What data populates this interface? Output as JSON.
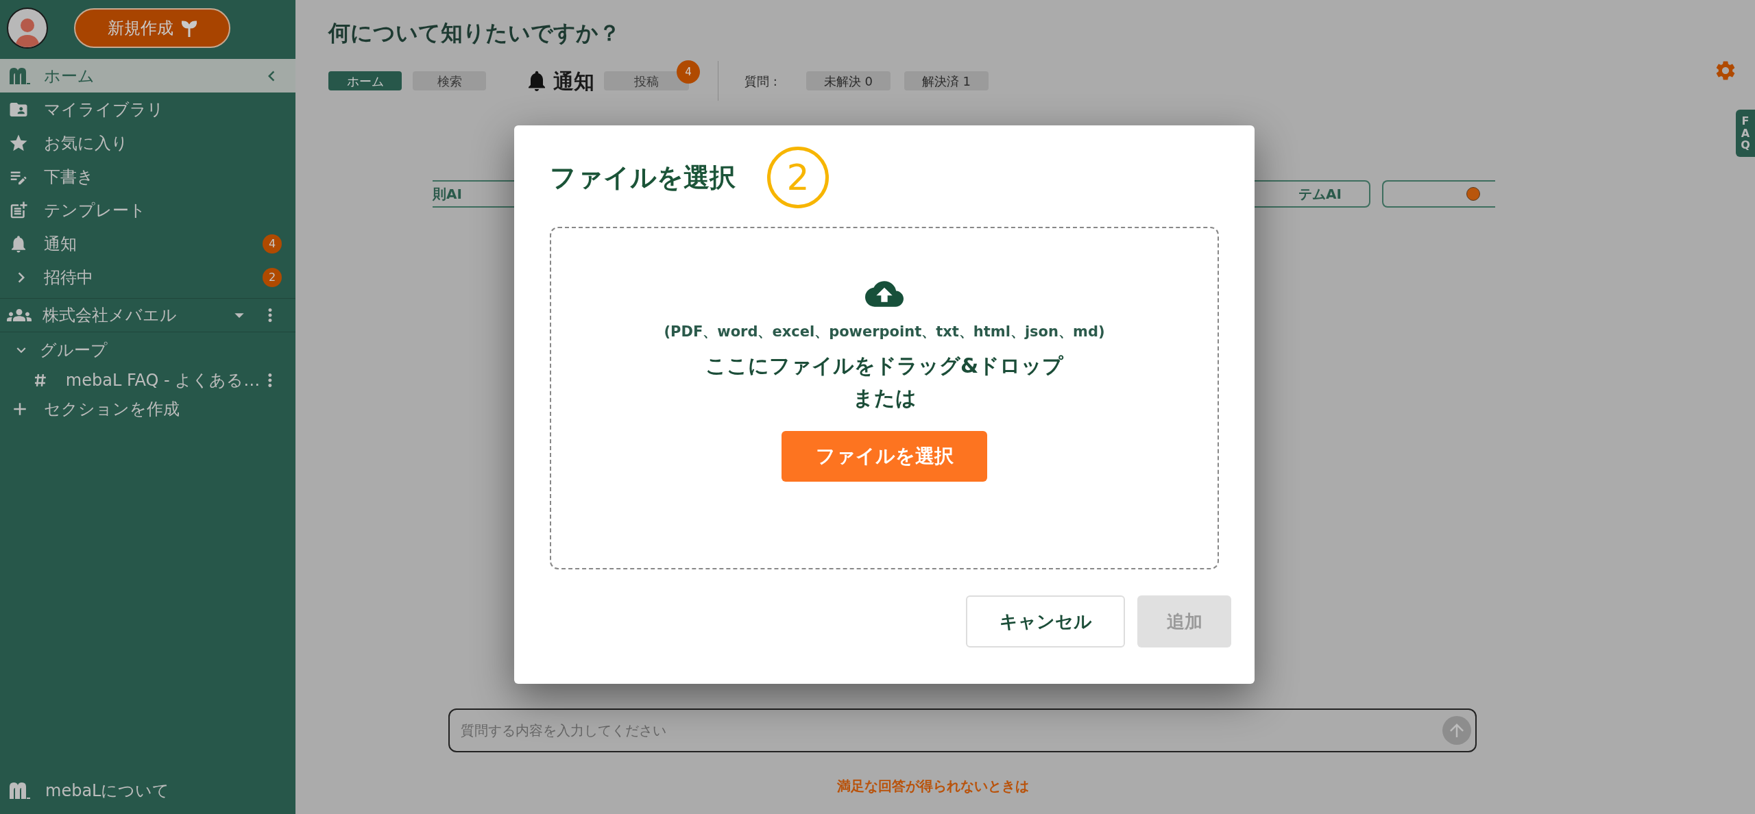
{
  "sidebar": {
    "new_button": "新規作成",
    "nav": [
      {
        "label": "ホーム",
        "selected": true
      },
      {
        "label": "マイライブラリ",
        "selected": false
      },
      {
        "label": "お気に入り",
        "selected": false
      },
      {
        "label": "下書き",
        "selected": false
      },
      {
        "label": "テンプレート",
        "selected": false
      },
      {
        "label": "通知",
        "selected": false,
        "badge": "4"
      },
      {
        "label": "招待中",
        "selected": false,
        "badge": "2",
        "expanded": false
      }
    ],
    "organization": "株式会社メバエル",
    "group": {
      "label": "グループ",
      "expanded": true,
      "children": [
        {
          "label": "mebaL FAQ - よくある…"
        }
      ]
    },
    "create_section": "セクションを作成",
    "about": "mebaLについて"
  },
  "main": {
    "title": "何について知りたいですか？",
    "tabs": [
      {
        "label": "ホーム",
        "selected": true
      },
      {
        "label": "検索",
        "selected": false
      }
    ],
    "notifications": {
      "label": "通知",
      "tabs": [
        {
          "label": "投稿",
          "badge": "4"
        }
      ]
    },
    "questions": {
      "label": "質問 :",
      "filters": [
        {
          "label": "未解決 0"
        },
        {
          "label": "解決済 1"
        }
      ]
    },
    "faq_tab": "FAQ",
    "chips": [
      {
        "kind": "text",
        "label": "則AI"
      },
      {
        "kind": "text",
        "label": "テムAI"
      },
      {
        "kind": "dot"
      }
    ],
    "chat": {
      "placeholder": "質問する内容を入力してください"
    },
    "help_link": "満足な回答が得られないときは"
  },
  "modal": {
    "title": "ファイルを選択",
    "step": "2",
    "formats": "(PDF、word、excel、powerpoint、txt、html、json、md)",
    "drop_text": "ここにファイルをドラッグ&ドロップ",
    "or_text": "または",
    "choose_button": "ファイルを選択",
    "buttons": [
      {
        "label": "キャンセル",
        "disabled": false
      },
      {
        "label": "追加",
        "disabled": true
      }
    ]
  }
}
